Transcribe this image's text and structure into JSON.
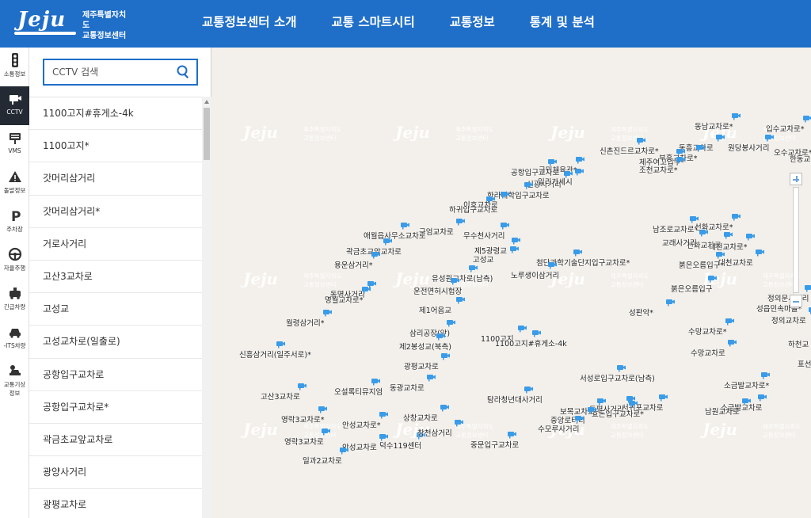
{
  "header": {
    "logo_text": "Jeju",
    "org_line1": "제주특별자치도",
    "org_line2": "교통정보센터",
    "nav": [
      {
        "label": "교통정보센터 소개"
      },
      {
        "label": "교통 스마트시티"
      },
      {
        "label": "교통정보"
      },
      {
        "label": "통계 및 분석"
      }
    ]
  },
  "rail": [
    {
      "label": "소통정보",
      "icon": "traffic-light-icon"
    },
    {
      "label": "CCTV",
      "icon": "cctv-camera-icon",
      "active": true
    },
    {
      "label": "VMS",
      "icon": "vms-board-icon"
    },
    {
      "label": "돌발정보",
      "icon": "warning-icon"
    },
    {
      "label": "주차장",
      "icon": "parking-icon"
    },
    {
      "label": "자율주행",
      "icon": "steering-wheel-icon"
    },
    {
      "label": "긴급차량",
      "icon": "emergency-vehicle-icon"
    },
    {
      "label": "-ITS차량",
      "icon": "its-vehicle-icon"
    },
    {
      "label": "교통기상",
      "label2": "정보",
      "icon": "weather-car-icon"
    }
  ],
  "search": {
    "placeholder": "CCTV 검색",
    "value": ""
  },
  "cctv_list": [
    "1100고지#휴게소-4k",
    "1100고지*",
    "갓머리삼거리",
    "갓머리삼거리*",
    "거로사거리",
    "고산3교차로",
    "고성교",
    "고성교차로(일출로)",
    "공항입구교차로",
    "공항입구교차로*",
    "곽금초교앞교차로",
    "광양사거리",
    "광평교차로"
  ],
  "map": {
    "watermark_logo": "Jeju",
    "watermark_line1": "제주특별자치도",
    "watermark_line2": "교통정보센터",
    "labels": [
      "동남교차로*",
      "입수교차로*",
      "동흥교차로",
      "원당봉사거리",
      "오수교차로*",
      "한동교",
      "신촌진드르교차로*",
      "제주여고입구*",
      "부흥교차로*",
      "국민체육관*",
      "조천교차로*",
      "공항입구교차로",
      "신광사거리",
      "일리가세시",
      "한라대학입구교차로",
      "이호교차로",
      "하귀입구교차로",
      "구엄교차로",
      "애월읍사무소교차로",
      "무수천사거리",
      "남조로교차로*",
      "선화교차로*",
      "선화교차로",
      "교래사거리",
      "대천교차로*",
      "대천교차로",
      "곽금초교앞교차로",
      "용운삼거리*",
      "제5광령교",
      "고성교",
      "첨단과학기술단지입구교차로*",
      "붉은오름입구*",
      "붉은오름입구",
      "유성원교차로(남측)",
      "노루생이삼거리",
      "운전면허시험장",
      "동명사거리",
      "명월교차로*",
      "제1어음교",
      "성판악*",
      "월령삼거리*",
      "정의문사거리",
      "성읍민속마을*",
      "정의교차로",
      "삼리공장(앞)",
      "1100고지",
      "1100고지#휴게소-4k",
      "제2봉성교(북측)",
      "신흥삼거리(일주서로)*",
      "수망교차로*",
      "수망교차로",
      "하천교",
      "광평교차로",
      "표선교",
      "서성로입구교차로(남측)",
      "고산3교차로",
      "오설록티뮤지엄",
      "동광교차로",
      "소금발교차로*",
      "소금발교차로",
      "남원교차로",
      "서귀포교차로",
      "토평사거리",
      "보목교차로",
      "효돈입구교차로*",
      "탐라청년대사거리",
      "영락3교차로*",
      "영락3교차로",
      "안성교차로*",
      "안성교차로",
      "덕수119센터",
      "창천삼거리",
      "상창교차로",
      "중앙로터리",
      "중문입구교차로",
      "수모루사거리",
      "일과2교차로"
    ]
  }
}
